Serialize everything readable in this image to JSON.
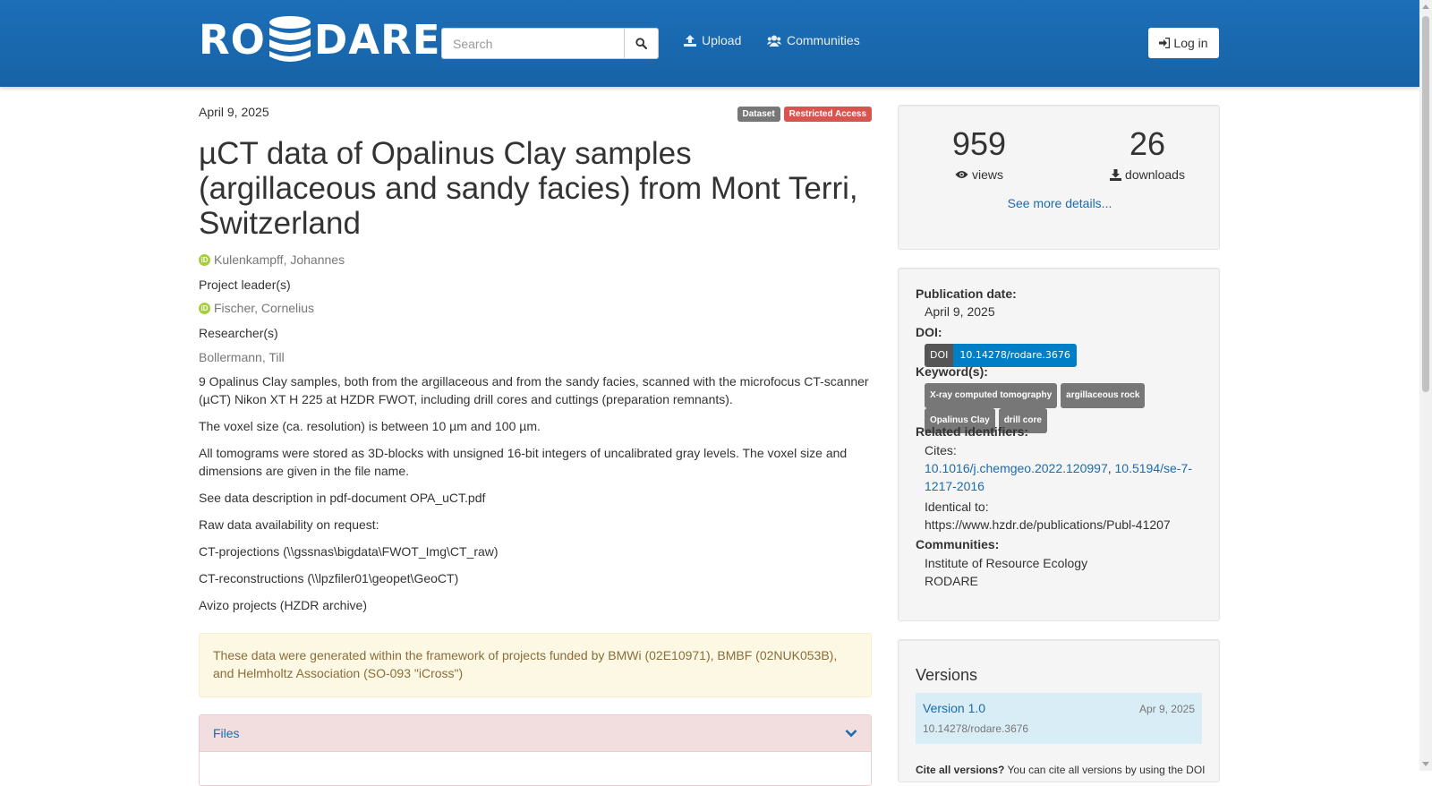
{
  "header": {
    "logo_left": "RO",
    "logo_right": "DARE",
    "search_placeholder": "Search",
    "nav": {
      "upload": "Upload",
      "communities": "Communities"
    },
    "login": "Log in"
  },
  "record": {
    "date": "April 9, 2025",
    "badges": {
      "type": "Dataset",
      "access": "Restricted Access"
    },
    "title": "µCT data of Opalinus Clay samples (argillaceous and sandy facies) from Mont Terri, Switzerland",
    "creator": "Kulenkampff, Johannes",
    "role1": "Project leader(s)",
    "project_leader": "Fischer, Cornelius",
    "role2": "Researcher(s)",
    "researcher": "Bollermann, Till",
    "description": [
      "9 Opalinus Clay samples, both from the argillaceous and from the sandy facies, scanned with the microfocus CT-scanner (µCT) Nikon XT H 225 at HZDR FWOT, including drill cores and cuttings (preparation remnants).",
      "The voxel size (ca. resolution) is between 10 µm and 100 µm.",
      "All tomograms were stored as 3D-blocks with unsigned 16-bit integers of uncalibrated gray levels. The voxel size and dimensions are given in the file name.",
      "See data description in pdf-document OPA_uCT.pdf",
      "Raw data availability on request:",
      "CT-projections (\\\\gssnas\\bigdata\\FWOT_Img\\CT_raw)",
      "CT-reconstructions (\\\\lpzfiler01\\geopet\\GeoCT)",
      "Avizo projects (HZDR archive)"
    ],
    "funding_note": "These data were generated within the framework of projects funded by BMWi (02E10971), BMBF (02NUK053B), and Helmholtz Association (SO-093 \"iCross\")",
    "files_label": "Files"
  },
  "stats": {
    "views": "959",
    "views_label": "views",
    "downloads": "26",
    "downloads_label": "downloads",
    "more_details": "See more details..."
  },
  "meta": {
    "pub_date_label": "Publication date:",
    "pub_date": "April 9, 2025",
    "doi_label": "DOI:",
    "doi_prefix": "DOI",
    "doi": "10.14278/rodare.3676",
    "keywords_label": "Keyword(s):",
    "keywords": [
      "X-ray computed tomography",
      "argillaceous rock",
      "Opalinus Clay",
      "drill core"
    ],
    "related_label": "Related identifiers:",
    "cites_label": "Cites:",
    "cites_1": "10.1016/j.chemgeo.2022.120997",
    "cites_sep": ",",
    "cites_2a": "10.5194/se-7-",
    "cites_2b": "1217-2016",
    "identical_label": "Identical to:",
    "identical": "https://www.hzdr.de/publications/Publ-41207",
    "communities_label": "Communities:",
    "communities": [
      "Institute of Resource Ecology",
      "RODARE"
    ]
  },
  "versions": {
    "title": "Versions",
    "items": [
      {
        "name": "Version 1.0",
        "date": "Apr 9, 2025",
        "doi": "10.14278/rodare.3676"
      }
    ],
    "cite_all_bold": "Cite all versions?",
    "cite_all_text": " You can cite all versions by using the DOI"
  },
  "colors": {
    "header": "#1c6fb8",
    "link": "#1a6bb0",
    "danger": "#d9534f",
    "doi_blue": "#007ec6"
  }
}
